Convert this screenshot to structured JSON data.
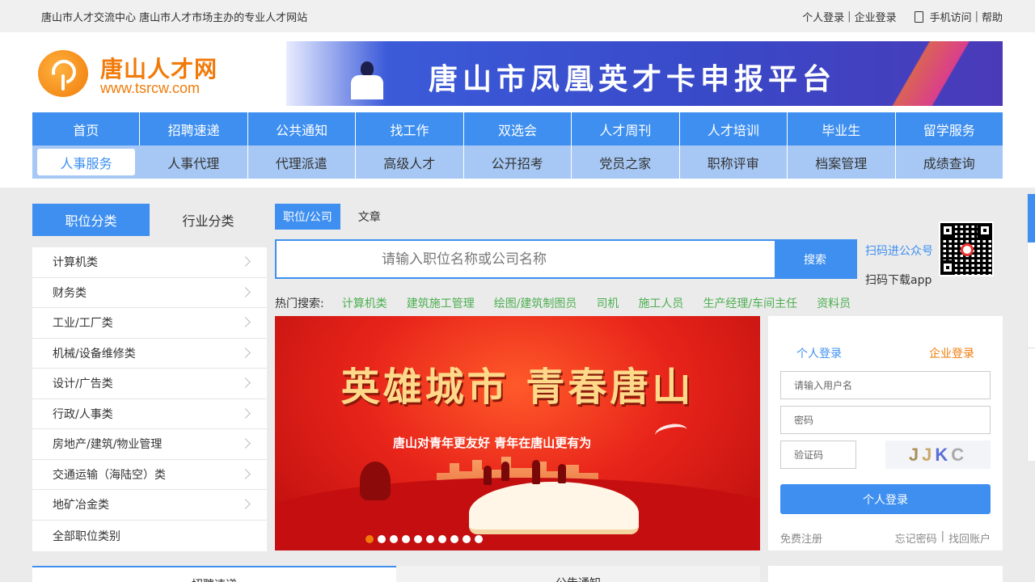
{
  "topbar": {
    "site_desc": "唐山市人才交流中心  唐山市人才市场主办的专业人才网站",
    "personal_login": "个人登录",
    "company_login": "企业登录",
    "sep": "|",
    "mobile": "手机访问",
    "help": "帮助"
  },
  "logo": {
    "name": "唐山人才网",
    "url": "www.tsrcw.com"
  },
  "banner": {
    "title": "唐山市凤凰英才卡申报平台"
  },
  "nav": {
    "primary": [
      "首页",
      "招聘速递",
      "公共通知",
      "找工作",
      "双选会",
      "人才周刊",
      "人才培训",
      "毕业生",
      "留学服务"
    ],
    "secondary": [
      "人事服务",
      "人事代理",
      "代理派遣",
      "高级人才",
      "公开招考",
      "党员之家",
      "职称评审",
      "档案管理",
      "成绩查询"
    ]
  },
  "category": {
    "tabs": [
      "职位分类",
      "行业分类"
    ],
    "items": [
      "计算机类",
      "财务类",
      "工业/工厂类",
      "机械/设备维修类",
      "设计/广告类",
      "行政/人事类",
      "房地产/建筑/物业管理",
      "交通运输（海陆空）类",
      "地矿冶金类",
      "全部职位类别"
    ]
  },
  "search": {
    "tabs": [
      "职位/公司",
      "文章"
    ],
    "placeholder": "请输入职位名称或公司名称",
    "button": "搜索",
    "qr_follow": "扫码进公众号",
    "qr_app": "扫码下载app"
  },
  "hot_search": {
    "label": "热门搜索:",
    "terms": [
      "计算机类",
      "建筑施工管理",
      "绘图/建筑制图员",
      "司机",
      "施工人员",
      "生产经理/车间主任",
      "资料员"
    ]
  },
  "hero": {
    "headline": "英雄城市  青春唐山",
    "subline": "唐山对青年更友好 青年在唐山更有为",
    "slide_count": 10,
    "active_slide": 1
  },
  "login": {
    "tab_personal": "个人登录",
    "tab_company": "企业登录",
    "username_placeholder": "请输入用户名",
    "password_placeholder": "密码",
    "captcha_placeholder": "验证码",
    "captcha_text": [
      "J",
      "J",
      "K",
      "C"
    ],
    "submit": "个人登录",
    "register": "免费注册",
    "forgot": "忘记密码",
    "recover": "找回账户"
  },
  "bottom_tabs": [
    "招聘速递",
    "公告通知"
  ],
  "colors": {
    "accent": "#3e8ff0",
    "brand_orange": "#f07b0a",
    "hot_term": "#4caf50",
    "hero_red": "#e8241a"
  }
}
